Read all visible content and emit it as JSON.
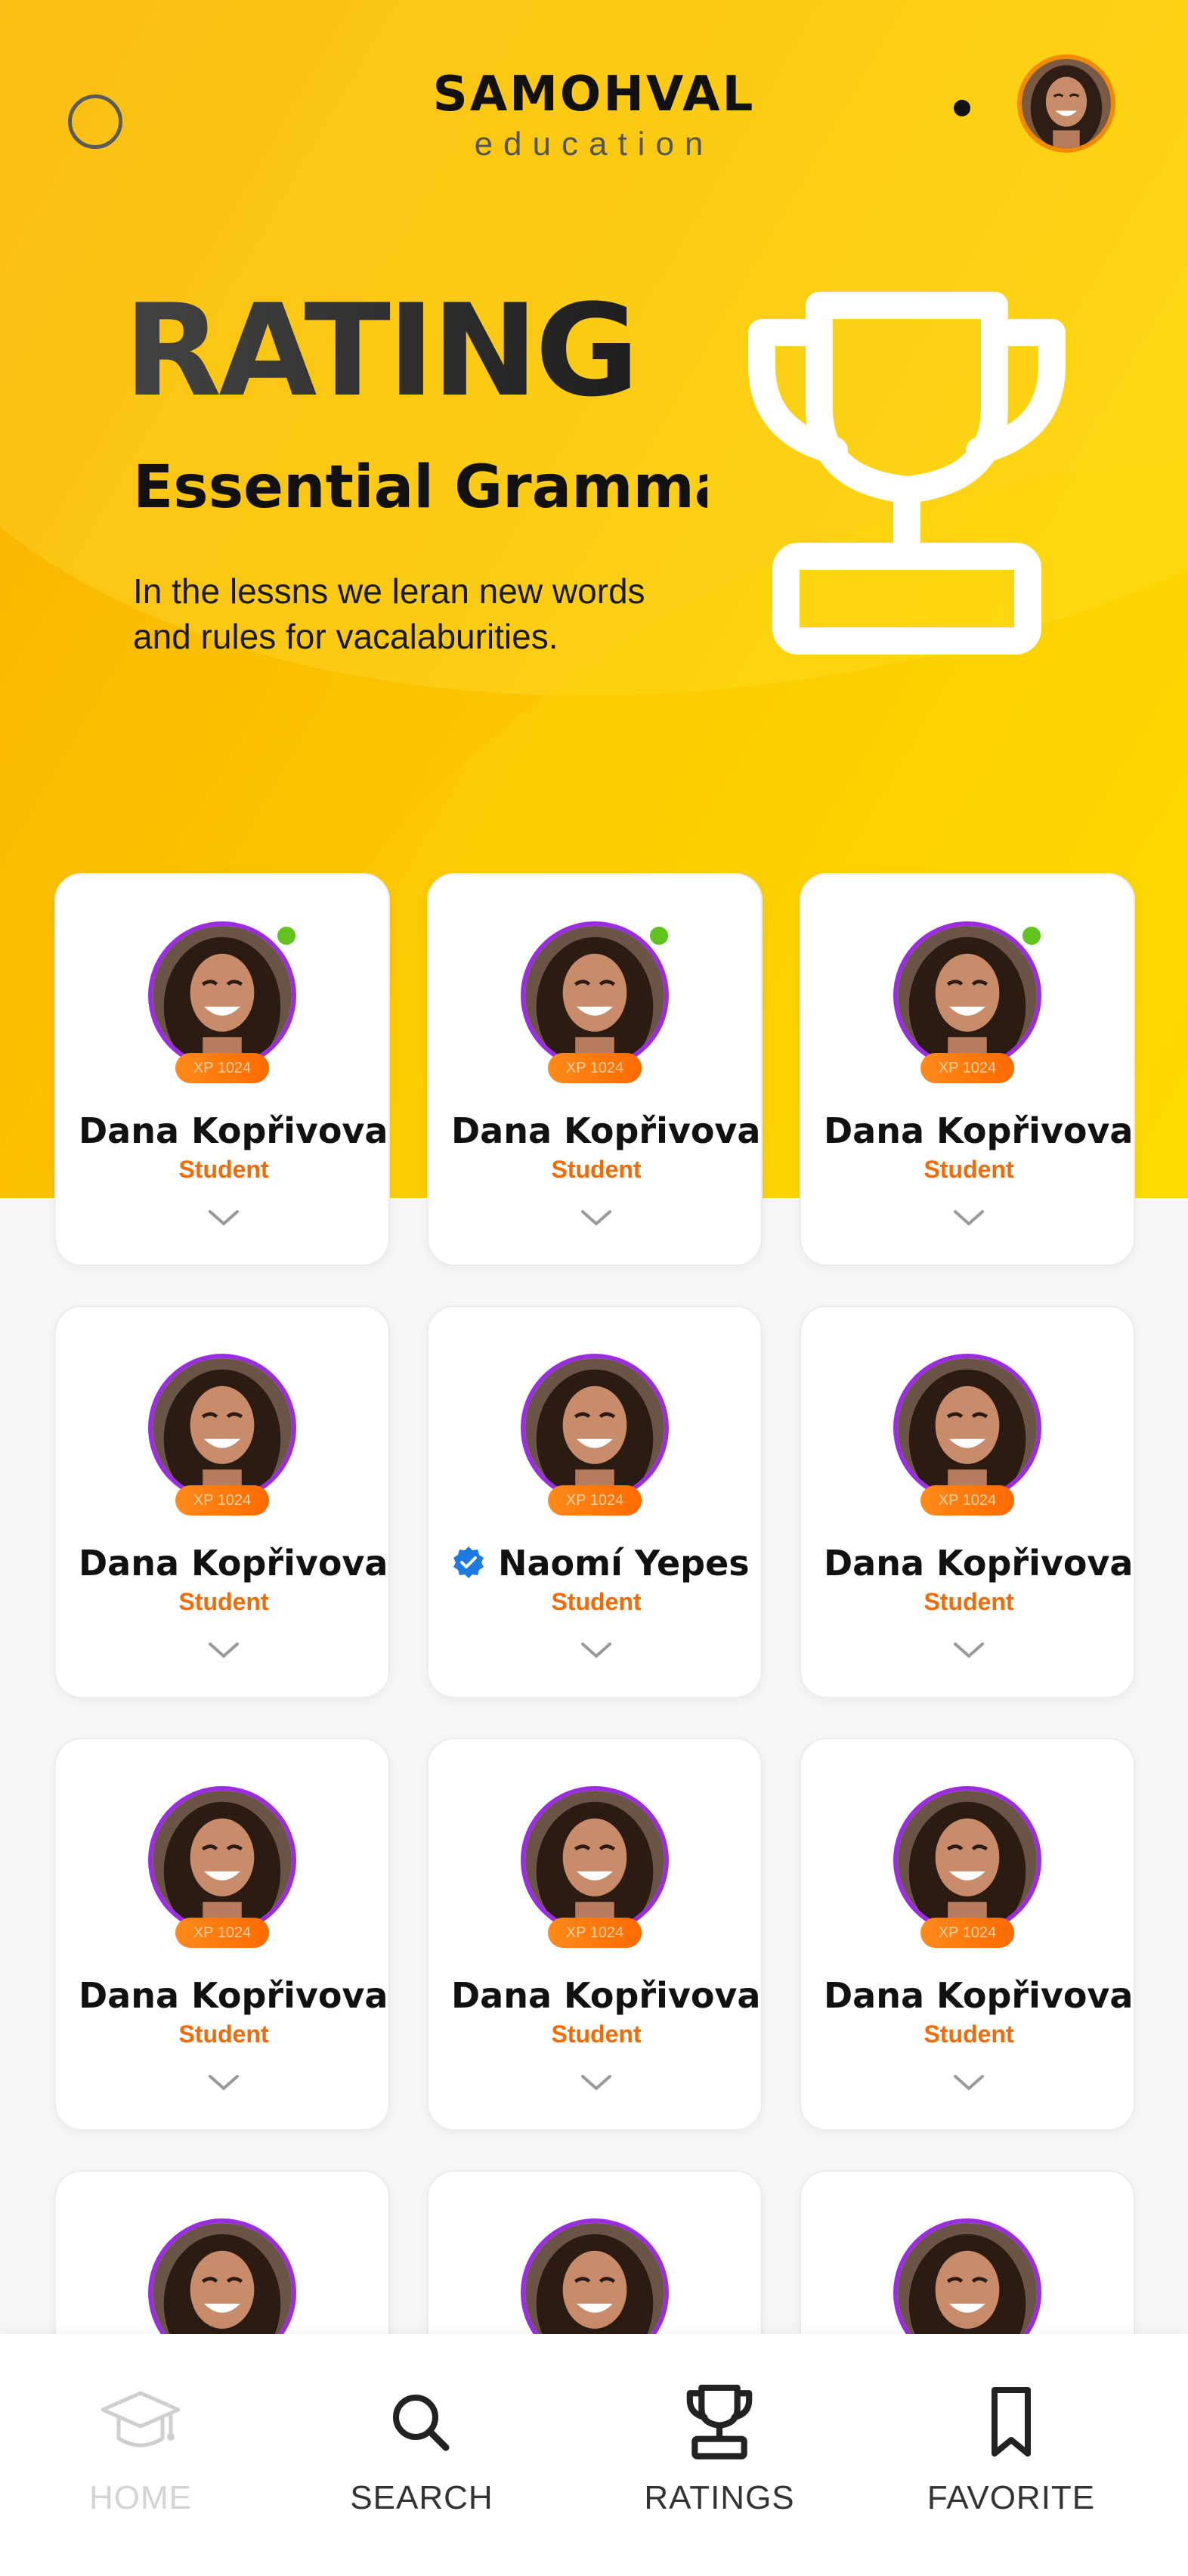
{
  "brand": {
    "name": "SAMOHVAL",
    "tagline": "education"
  },
  "hero": {
    "title": "RATING",
    "course": "Essential Grammar",
    "description": "In the lessns we leran new words and rules for vacalaburities."
  },
  "colors": {
    "accent": "#fbc400",
    "orange": "#f26b06",
    "purple": "#9b2de0",
    "online": "#62c31e",
    "verified": "#1f7ae0"
  },
  "students": [
    {
      "name": "Dana Kopřivova",
      "role": "Student",
      "xp": "XP 1024",
      "online": true,
      "verified": false
    },
    {
      "name": "Dana Kopřivova",
      "role": "Student",
      "xp": "XP 1024",
      "online": true,
      "verified": false
    },
    {
      "name": "Dana Kopřivova",
      "role": "Student",
      "xp": "XP 1024",
      "online": true,
      "verified": false
    },
    {
      "name": "Dana Kopřivova",
      "role": "Student",
      "xp": "XP 1024",
      "online": false,
      "verified": false
    },
    {
      "name": "Naomí Yepes",
      "role": "Student",
      "xp": "XP 1024",
      "online": false,
      "verified": true
    },
    {
      "name": "Dana Kopřivova",
      "role": "Student",
      "xp": "XP 1024",
      "online": false,
      "verified": false
    },
    {
      "name": "Dana Kopřivova",
      "role": "Student",
      "xp": "XP 1024",
      "online": false,
      "verified": false
    },
    {
      "name": "Dana Kopřivova",
      "role": "Student",
      "xp": "XP 1024",
      "online": false,
      "verified": false
    },
    {
      "name": "Dana Kopřivova",
      "role": "Student",
      "xp": "XP 1024",
      "online": false,
      "verified": false
    },
    {
      "name": "",
      "role": "",
      "xp": "",
      "online": false,
      "verified": false
    },
    {
      "name": "",
      "role": "",
      "xp": "",
      "online": false,
      "verified": false
    },
    {
      "name": "",
      "role": "",
      "xp": "",
      "online": false,
      "verified": false
    }
  ],
  "nav": {
    "home": "HOME",
    "search": "SEARCH",
    "ratings": "RATINGS",
    "favorite": "FAVORITE"
  }
}
